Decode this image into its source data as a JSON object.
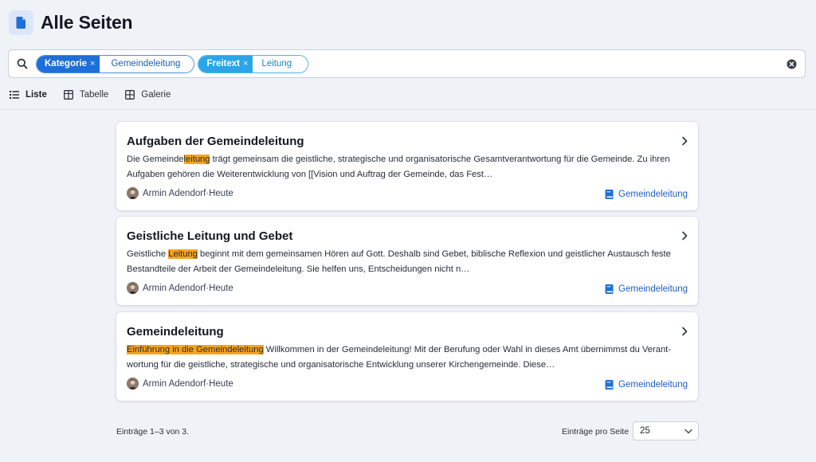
{
  "header": {
    "title": "Alle Seiten",
    "icon": "document-icon",
    "icon_color": "#1e6fd9"
  },
  "search": {
    "filters": [
      {
        "key": "Kategorie",
        "remove": "×",
        "value": "Gemeindeleitung"
      },
      {
        "key": "Freitext",
        "remove": "×",
        "value": "Leitung"
      }
    ],
    "clear_icon": "clear-circle-icon"
  },
  "views": [
    {
      "label": "Liste",
      "icon": "list-icon",
      "active": true
    },
    {
      "label": "Tabelle",
      "icon": "table-icon",
      "active": false
    },
    {
      "label": "Galerie",
      "icon": "gallery-icon",
      "active": false
    }
  ],
  "results": [
    {
      "title": "Aufgaben der Gemeindeleitung",
      "text_before": "Die Gemeinde",
      "highlight": "leitung",
      "text_after": " trägt gemeinsam die geistliche, strategische und organisatorische Gesamtverantwortung für die Gemeinde. Zu ihren Aufgaben gehören die Weiterentwicklung von [[Vision und Auftrag der Gemeinde, das Fest…",
      "author": "Armin Adendorf",
      "separator": " · ",
      "date": "Heute",
      "category": "Gemeindeleitung"
    },
    {
      "title": "Geistliche Leitung und Gebet",
      "text_before": "Geistliche ",
      "highlight": "Leitung",
      "text_after": " beginnt mit dem gemeinsamen Hören auf Gott. Deshalb sind Gebet, biblische Reflexion und geistlicher Austausch feste Bestandteile der Arbeit der Gemeindeleitung. Sie helfen uns, Entscheidungen nicht n…",
      "author": "Armin Adendorf",
      "separator": " · ",
      "date": "Heute",
      "category": "Gemeindeleitung"
    },
    {
      "title": "Gemeindeleitung",
      "text_before": "",
      "highlight": "Einführung in die Gemeindeleitung",
      "text_after": " Willkommen in der Gemeindeleitung! Mit der Berufung oder Wahl in dieses Amt übernimmst du Verant­wortung für die geistliche, strategische und organisatorische Entwicklung unserer Kirchengemeinde. Diese…",
      "author": "Armin Adendorf",
      "separator": " · ",
      "date": "Heute",
      "category": "Gemeindeleitung"
    }
  ],
  "footer": {
    "count_text": "Einträge 1–3 von 3.",
    "per_page_label": "Einträge pro Seite",
    "per_page_value": "25"
  },
  "colors": {
    "accent": "#1e6fd9",
    "freitext": "#2aa6e8",
    "highlight": "#f8a41c",
    "background": "#eff2f7"
  }
}
